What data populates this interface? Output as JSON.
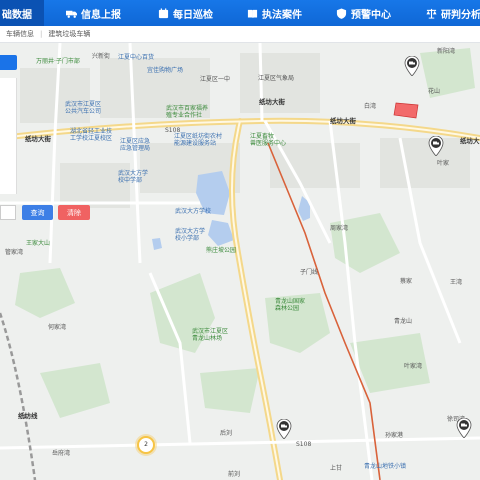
{
  "nav": {
    "items": [
      {
        "label": "础数据",
        "icon": "none"
      },
      {
        "label": "信息上报",
        "icon": "truck-icon"
      },
      {
        "label": "每日巡检",
        "icon": "calendar-icon"
      },
      {
        "label": "执法案件",
        "icon": "book-icon"
      },
      {
        "label": "预警中心",
        "icon": "shield-icon"
      },
      {
        "label": "研判分析",
        "icon": "scale-icon"
      }
    ]
  },
  "breadcrumb": [
    "车辆信息",
    "建筑垃圾车辆"
  ],
  "panel": {
    "query_label": "查询",
    "reset_label": "清除"
  },
  "map": {
    "labels": {
      "l1": "万丽井·子门市部",
      "l2": "江夏中心百货",
      "l3": "宜佳购物广场",
      "l4": "江夏区一中",
      "l5": "江夏区气象局",
      "l6": "武汉市江夏区\n公共汽车公司",
      "l7": "湖北省轻工业技\n工学校江夏校区",
      "l8": "武汉市百家福养\n殖专业合作社",
      "l9": "纸坊大街",
      "l10": "江夏区应急\n应急管理局",
      "l11": "江夏区纸坊街农村\n能源建设服务站",
      "l12": "江夏畜牧\n兽医服务中心",
      "l13": "武汉大方学\n校中学部",
      "l14": "青龙山国家\n森林公园",
      "l15": "武汉市江夏区\n青龙山林场",
      "l16": "武汉大方学\n校小学部",
      "l17": "熊庄坡公园",
      "l18": "武汉大方学校",
      "l19": "纸坊大街",
      "l20": "纸坊大",
      "l21": "青龙山地铁小镇",
      "l22": "纸坊大街",
      "l23": "管家湾",
      "l24": "何家湾",
      "l25": "王湾",
      "l26": "蔡家",
      "l27": "后刘",
      "l28": "上甘",
      "l29": "徐司湾",
      "l30": "纸坊线",
      "l31": "新阳湾",
      "l32": "叶家",
      "l33": "兴新街",
      "l34": "花山",
      "l35": "周家湾",
      "l36": "岳府湾",
      "l37": "孙家港",
      "l38": "前刘",
      "l39": "王家大山",
      "l40": "S108",
      "l41": "S108",
      "l42": "叶家湾",
      "l43": "白湾",
      "l44": "青龙山",
      "l45": "子门线"
    },
    "cluster_count": "2"
  },
  "colors": {
    "nav_bg": "#1777e8",
    "nav_active": "#0b52b3",
    "query": "#3d7fe6",
    "reset": "#f06262",
    "rail": "#d9623a"
  }
}
